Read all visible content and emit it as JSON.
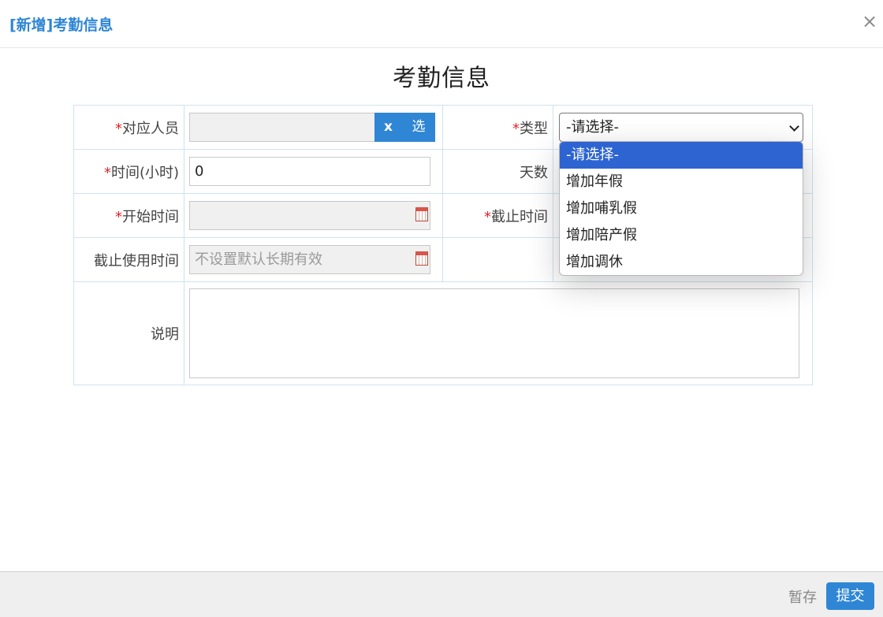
{
  "dialog": {
    "title": "[新增]考勤信息",
    "close_label": "×"
  },
  "form": {
    "title": "考勤信息",
    "required_mark": "*",
    "person": {
      "label": "对应人员",
      "value": "",
      "clear_label": "x",
      "select_label": "选"
    },
    "type": {
      "label": "类型",
      "selected": "-请选择-",
      "options": [
        "-请选择-",
        "增加年假",
        "增加哺乳假",
        "增加陪产假",
        "增加调休"
      ],
      "highlighted_index": 0
    },
    "hours": {
      "label": "时间(小时)",
      "value": "0"
    },
    "days": {
      "label": "天数"
    },
    "start": {
      "label": "开始时间",
      "value": ""
    },
    "end": {
      "label": "截止时间"
    },
    "use_deadline": {
      "label": "截止使用时间",
      "placeholder": "不设置默认长期有效"
    },
    "note": {
      "label": "说明",
      "value": ""
    }
  },
  "footer": {
    "save_label": "暂存",
    "submit_label": "提交"
  },
  "colors": {
    "accent": "#2e86d4",
    "required": "#e0242a",
    "highlight": "#2d64d2"
  },
  "icons": [
    "close-icon",
    "calendar-icon",
    "chevron-down-icon"
  ]
}
